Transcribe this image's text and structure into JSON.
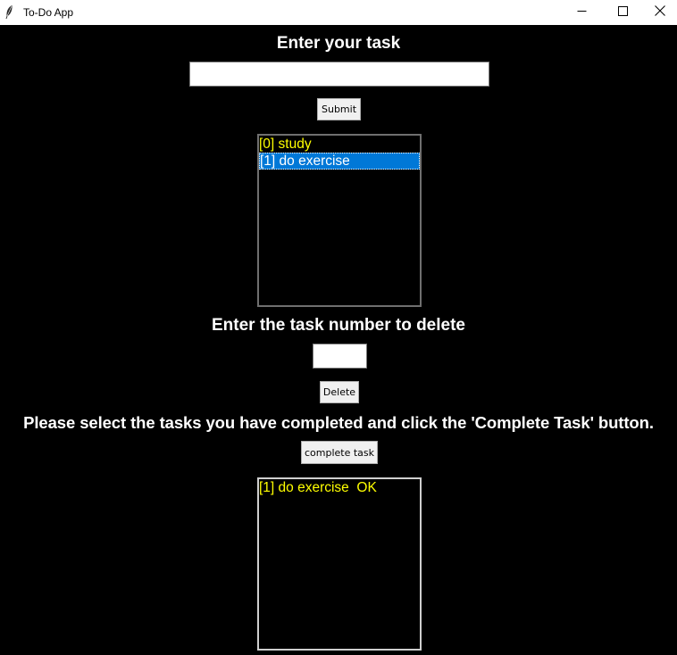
{
  "window": {
    "title": "To-Do App",
    "controls": {
      "minimize_icon": "minimize-icon",
      "maximize_icon": "maximize-icon",
      "close_icon": "close-icon"
    },
    "app_icon": "feather-icon"
  },
  "task_entry": {
    "heading": "Enter your task",
    "value": "",
    "submit_label": "Submit"
  },
  "task_list": {
    "items": [
      {
        "text": "[0] study",
        "selected": false
      },
      {
        "text": "[1] do exercise",
        "selected": true
      }
    ]
  },
  "delete_section": {
    "heading": "Enter the task number to delete",
    "value": "",
    "delete_label": "Delete"
  },
  "complete_section": {
    "heading": "Please select the tasks you have completed and click the 'Complete Task' button.",
    "button_label": "complete task"
  },
  "completed_list": {
    "items": [
      {
        "text": "[1] do exercise  OK"
      }
    ]
  },
  "colors": {
    "background": "#000000",
    "item_text": "#ffff00",
    "selection": "#0078d7",
    "heading_text": "#ffffff"
  }
}
